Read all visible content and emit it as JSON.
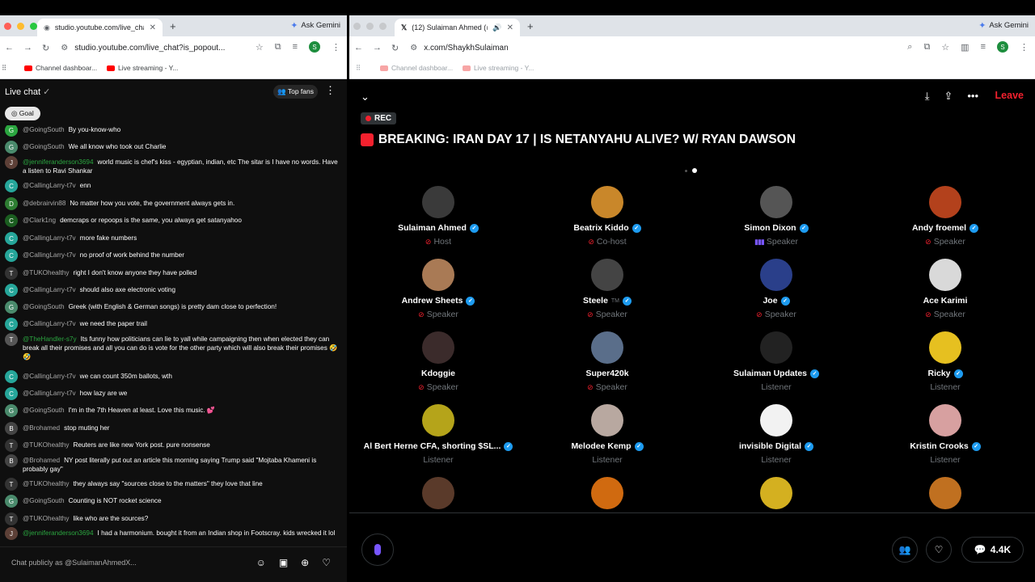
{
  "left": {
    "tab_title": "studio.youtube.com/live_chat",
    "url": "studio.youtube.com/live_chat?is_popout...",
    "ask_gemini": "Ask Gemini",
    "profile_letter": "S",
    "bookmarks": [
      "Channel dashboar...",
      "Live streaming - Y..."
    ],
    "chat_title": "Live chat",
    "top_fans": "Top fans",
    "goal": "Goal",
    "input_placeholder": "Chat publicly as @SulaimanAhmedX...",
    "messages": [
      {
        "user": "@GoingSouth",
        "text": "By you-know-who",
        "color": "#2ba640",
        "av": "G"
      },
      {
        "user": "@GoingSouth",
        "text": "We all know who took out Charlie",
        "color": "#4a8a6c",
        "av": "G"
      },
      {
        "user": "@jenniferanderson3694",
        "text": "world music is chef's kiss - egyptian, indian, etc The sitar is I have no words. Have a listen to Ravi Shankar",
        "color": "#5d4037",
        "av": "J",
        "green": true
      },
      {
        "user": "@CallingLarry-t7v",
        "text": "enn",
        "color": "#26a69a",
        "av": "C"
      },
      {
        "user": "@debrairvin88",
        "text": "No matter how you vote, the government always gets in.",
        "color": "#2e7d32",
        "av": "D"
      },
      {
        "user": "@Clark1ng",
        "text": "demcraps or repoops is the same, you always get satanyahoo",
        "color": "#1b5e20",
        "av": "C"
      },
      {
        "user": "@CallingLarry-t7v",
        "text": "more fake numbers",
        "color": "#26a69a",
        "av": "C"
      },
      {
        "user": "@CallingLarry-t7v",
        "text": "no proof of work behind the number",
        "color": "#26a69a",
        "av": "C"
      },
      {
        "user": "@TUKOhealthy",
        "text": "right I don't know anyone they have polled",
        "color": "#333",
        "av": "T"
      },
      {
        "user": "@CallingLarry-t7v",
        "text": "should also axe electronic voting",
        "color": "#26a69a",
        "av": "C"
      },
      {
        "user": "@GoingSouth",
        "text": "Greek (with English & German songs) is pretty dam close to perfection!",
        "color": "#4a8a6c",
        "av": "G"
      },
      {
        "user": "@CallingLarry-t7v",
        "text": "we need the paper trail",
        "color": "#26a69a",
        "av": "C"
      },
      {
        "user": "@TheHandler-s7y",
        "text": "Its funny how politicians can lie to yall while campaigning then when elected they can break all their promises and all you can do is vote for the other party which will also break their promises 🤣🤣",
        "color": "#555",
        "av": "T",
        "green": true
      },
      {
        "user": "@CallingLarry-t7v",
        "text": "we can count 350m ballots, wth",
        "color": "#26a69a",
        "av": "C"
      },
      {
        "user": "@CallingLarry-t7v",
        "text": "how lazy are we",
        "color": "#26a69a",
        "av": "C"
      },
      {
        "user": "@GoingSouth",
        "text": "I'm in the 7th Heaven at least. Love this music. 💕",
        "color": "#4a8a6c",
        "av": "G"
      },
      {
        "user": "@Brohamed",
        "text": "stop muting her",
        "color": "#444",
        "av": "B"
      },
      {
        "user": "@TUKOhealthy",
        "text": "Reuters are like new York post. pure nonsense",
        "color": "#333",
        "av": "T"
      },
      {
        "user": "@Brohamed",
        "text": "NY post literally put out an article this morning saying Trump said \"Mojtaba Khameni is probably gay\"",
        "color": "#444",
        "av": "B"
      },
      {
        "user": "@TUKOhealthy",
        "text": "they always say \"sources close to the matters\" they love that line",
        "color": "#333",
        "av": "T"
      },
      {
        "user": "@GoingSouth",
        "text": "Counting is NOT rocket science",
        "color": "#4a8a6c",
        "av": "G"
      },
      {
        "user": "@TUKOhealthy",
        "text": "like who are the sources?",
        "color": "#333",
        "av": "T"
      },
      {
        "user": "@jenniferanderson3694",
        "text": "I had a harmonium. bought it from an Indian shop in Footscray. kids wrecked it lol",
        "color": "#5d4037",
        "av": "J",
        "green": true
      }
    ]
  },
  "right": {
    "tab_title": "(12) Sulaiman Ahmed (@S",
    "url": "x.com/ShaykhSulaiman",
    "ask_gemini": "Ask Gemini",
    "profile_letter": "S",
    "bookmarks": [
      "Channel dashboar...",
      "Live streaming - Y..."
    ],
    "leave": "Leave",
    "rec": "REC",
    "space_title": "BREAKING: IRAN DAY 17 | IS NETANYAHU ALIVE? W/ RYAN DAWSON",
    "comment_count": "4.4K",
    "speakers": [
      {
        "name": "Sulaiman Ahmed",
        "role": "Host",
        "verified": true,
        "mic": "muted",
        "color": "#3a3a3a"
      },
      {
        "name": "Beatrix Kiddo",
        "role": "Co-host",
        "verified": true,
        "mic": "muted",
        "color": "#c9872a"
      },
      {
        "name": "Simon Dixon",
        "role": "Speaker",
        "verified": true,
        "mic": "talking",
        "color": "#555"
      },
      {
        "name": "Andy froemel",
        "role": "Speaker",
        "verified": true,
        "mic": "muted",
        "color": "#b3411c"
      },
      {
        "name": "Andrew Sheets",
        "role": "Speaker",
        "verified": true,
        "mic": "muted",
        "color": "#a97a55"
      },
      {
        "name": "Steele",
        "name_suffix": "TM",
        "role": "Speaker",
        "verified": true,
        "mic": "muted",
        "color": "#444"
      },
      {
        "name": "Joe",
        "role": "Speaker",
        "verified": true,
        "mic": "muted",
        "color": "#2a3f8a"
      },
      {
        "name": "Ace Karimi",
        "role": "Speaker",
        "verified": false,
        "mic": "muted",
        "color": "#d9d9d9"
      },
      {
        "name": "Kdoggie",
        "role": "Speaker",
        "verified": false,
        "mic": "muted",
        "color": "#3b2b2b"
      },
      {
        "name": "Super420k",
        "role": "Speaker",
        "verified": false,
        "mic": "muted",
        "color": "#5a6e8a"
      },
      {
        "name": "Sulaiman Updates",
        "role": "Listener",
        "verified": true,
        "mic": "none",
        "color": "#222"
      },
      {
        "name": "Ricky",
        "role": "Listener",
        "verified": true,
        "mic": "none",
        "color": "#e6c020"
      },
      {
        "name": "Al Bert Herne CFA, shorting $SL...",
        "role": "Listener",
        "verified": true,
        "mic": "none",
        "color": "#b5a41a"
      },
      {
        "name": "Melodee Kemp",
        "role": "Listener",
        "verified": true,
        "mic": "none",
        "color": "#b8a8a0"
      },
      {
        "name": "invisible Digital",
        "role": "Listener",
        "verified": true,
        "mic": "none",
        "color": "#f2f2f2"
      },
      {
        "name": "Kristin Crooks",
        "role": "Listener",
        "verified": true,
        "mic": "none",
        "color": "#d7a0a0"
      },
      {
        "name": "",
        "role": "",
        "verified": false,
        "mic": "none",
        "color": "#5a3a2a"
      },
      {
        "name": "",
        "role": "",
        "verified": false,
        "mic": "none",
        "color": "#d06a10"
      },
      {
        "name": "",
        "role": "",
        "verified": false,
        "mic": "none",
        "color": "#d4b020"
      },
      {
        "name": "",
        "role": "",
        "verified": false,
        "mic": "none",
        "color": "#c07020"
      }
    ]
  },
  "colors": {
    "accent_x": "#1d9bf0",
    "leave": "#f4212e",
    "yt_green": "#2ba640",
    "purple": "#7856ff"
  }
}
